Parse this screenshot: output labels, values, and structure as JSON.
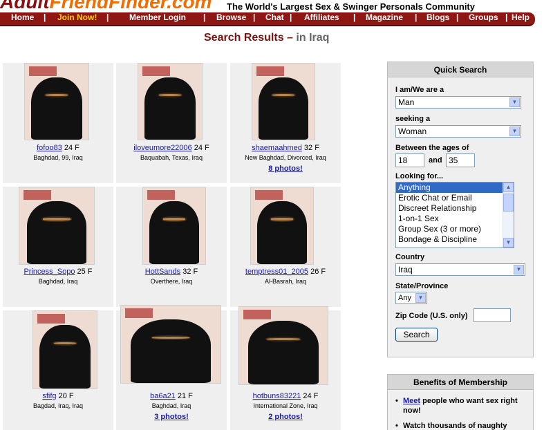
{
  "header": {
    "logo_part1": "Adult",
    "logo_part2": "FriendFinder.com",
    "tagline": "The World's Largest Sex & Swinger Personals Community"
  },
  "nav": {
    "items": [
      "Home",
      "Join Now!",
      "Member Login",
      "Browse",
      "Chat",
      "Affiliates",
      "Magazine",
      "Blogs",
      "Groups",
      "Help"
    ],
    "separator": "|"
  },
  "title": {
    "main": "Search Results",
    "dash": " – ",
    "location": "in Iraq"
  },
  "results": [
    {
      "username": "fofoo83",
      "age_gender": "24 F",
      "location": "Baghdad, 99, Iraq",
      "photos": ""
    },
    {
      "username": "iloveumore22006",
      "age_gender": "24 F",
      "location": "Baquabah, Texas, Iraq",
      "photos": ""
    },
    {
      "username": "shaemaahmed",
      "age_gender": "32 F",
      "location": "New Baghdad, Divorced, Iraq",
      "photos": "8 photos!"
    },
    {
      "username": "Princess_Sopo",
      "age_gender": "25 F",
      "location": "Baghdad, Iraq",
      "photos": ""
    },
    {
      "username": "HottSands",
      "age_gender": "32 F",
      "location": "Overthere, Iraq",
      "photos": ""
    },
    {
      "username": "temptress01_2005",
      "age_gender": "26 F",
      "location": "Al-Basrah, Iraq",
      "photos": ""
    },
    {
      "username": "sfifg",
      "age_gender": "20 F",
      "location": "Bagdad, Iraq, Iraq",
      "photos": ""
    },
    {
      "username": "ba6a21",
      "age_gender": "21 F",
      "location": "Baghdad, Iraq",
      "photos": "3 photos!"
    },
    {
      "username": "hotbuns83221",
      "age_gender": "24 F",
      "location": "International Zone, Iraq",
      "photos": "2 photos!"
    }
  ],
  "quick_search": {
    "title": "Quick Search",
    "iam_label": "I am/We are a",
    "iam_value": "Man",
    "seeking_label": "seeking a",
    "seeking_value": "Woman",
    "ages_label": "Between the ages of",
    "age_min": "18",
    "and_label": "and",
    "age_max": "35",
    "looking_label": "Looking for...",
    "looking_options": [
      "Anything",
      "Erotic Chat or Email",
      "Discreet Relationship",
      "1-on-1 Sex",
      "Group Sex (3 or more)",
      "Bondage & Discipline"
    ],
    "looking_selected": "Anything",
    "country_label": "Country",
    "country_value": "Iraq",
    "state_label": "State/Province",
    "state_value": "Any",
    "zip_label": "Zip Code (U.S. only)",
    "zip_value": "",
    "search_button": "Search"
  },
  "benefits": {
    "title": "Benefits of Membership",
    "item1_link": "Meet",
    "item1_text": " people who want sex right now!",
    "item2_text": "Watch thousands of naughty"
  },
  "colors": {
    "nav_bg": "#8f1713",
    "nav_highlight": "#ffcc00",
    "logo_dark": "#8a1111",
    "logo_orange": "#f26d00",
    "link": "#1a1aa6",
    "panel_bg": "#efefef",
    "listbox_selected": "#316ac5"
  }
}
